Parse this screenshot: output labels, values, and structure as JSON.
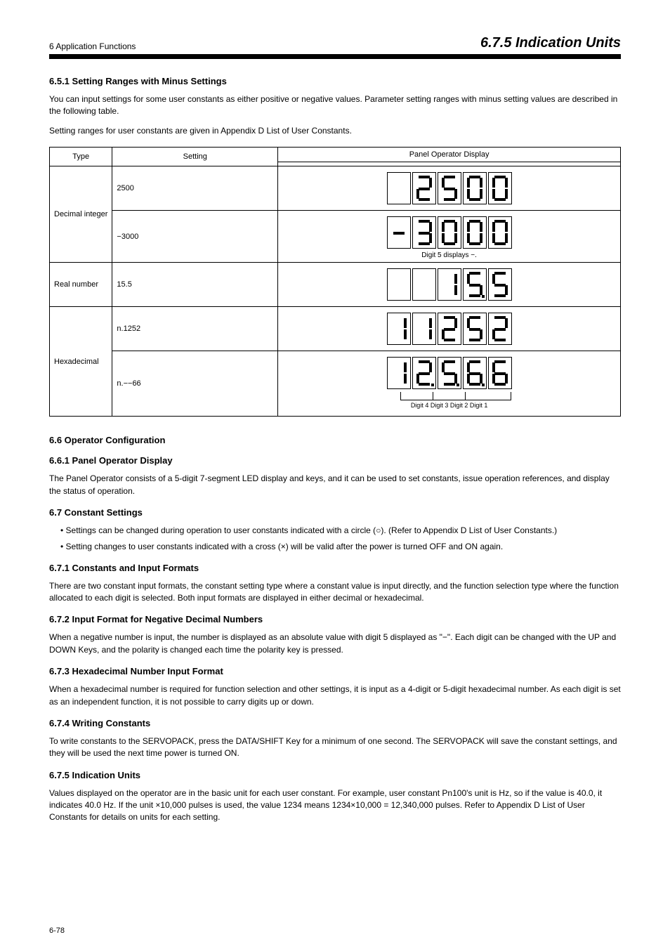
{
  "header": {
    "chapter": "6 Application Functions",
    "section_title": "6.7.5 Indication Units"
  },
  "h651": "6.5.1  Setting Ranges with Minus Settings",
  "p1": "You can input settings for some user constants as either positive or negative values. Parameter setting ranges with minus setting values are described in the following table.",
  "p2": "Setting ranges for user constants are given in Appendix D List of User Constants.",
  "h66": "6.6  Operator Configuration",
  "h661": "6.6.1  Panel Operator Display",
  "p3": "The Panel Operator consists of a 5-digit 7-segment LED display and keys, and it can be used to set constants, issue operation references, and display the status of operation.",
  "h67": "6.7  Constant Settings",
  "ul": [
    "Settings can be changed during operation to user constants indicated with a circle (○). (Refer to Appendix D List of User Constants.)",
    "Setting changes to user constants indicated with a cross (×) will be valid after the power is turned OFF and ON again."
  ],
  "table": {
    "hdr_type": "Type",
    "hdr_set": "Setting",
    "hdr_disp": "Panel Operator Display",
    "rows": [
      {
        "type": "Decimal integer",
        "sets": [
          {
            "set": "2500",
            "digits": [
              " ",
              "2",
              "5",
              "0",
              "0"
            ],
            "cap": ""
          },
          {
            "set": "−3000",
            "digits": [
              "-",
              "3",
              "0",
              "0",
              "0"
            ],
            "cap": "Digit 5 displays −."
          }
        ]
      },
      {
        "type": "Real number",
        "sets": [
          {
            "set": "15.5",
            "digits": [
              " ",
              " ",
              "1",
              "5.",
              "5"
            ],
            "cap": ""
          }
        ]
      },
      {
        "type": "Hexadecimal",
        "sets": [
          {
            "set": "n.1252",
            "digits": [
              "1",
              "1",
              "2",
              "5",
              "2"
            ],
            "cap": ""
          },
          {
            "set": "n.−−66",
            "digits": [
              "1",
              "2.",
              "5.",
              "6.",
              "6"
            ],
            "cap": "arrows"
          }
        ]
      }
    ],
    "arrow_labels": "Digit 4  Digit 3  Digit 2  Digit 1"
  },
  "h671": "6.7.1  Constants and Input Formats",
  "p671": "There are two constant input formats, the constant setting type where a constant value is input directly, and the function selection type where the function allocated to each digit is selected. Both input formats are displayed in either decimal or hexadecimal.",
  "h672": "6.7.2  Input Format for Negative Decimal Numbers",
  "p672": "When a negative number is input, the number is displayed as an absolute value with digit 5 displayed as \"−\". Each digit can be changed with the UP and DOWN Keys, and the polarity is changed each time the polarity key is pressed.",
  "h673": "6.7.3  Hexadecimal Number Input Format",
  "p673": "When a hexadecimal number is required for function selection and other settings, it is input as a 4-digit or 5-digit hexadecimal number. As each digit is set as an independent function, it is not possible to carry digits up or down.",
  "h674": "6.7.4  Writing Constants",
  "p674": "To write constants to the SERVOPACK, press the DATA/SHIFT Key for a minimum of one second. The SERVOPACK will save the constant settings, and they will be used the next time power is turned ON.",
  "h675": "6.7.5  Indication Units",
  "p675": "Values displayed on the operator are in the basic unit for each user constant. For example, user constant Pn100's unit is Hz, so if the value is 40.0, it indicates 40.0 Hz. If the unit ×10,000 pulses is used, the value 1234 means 1234×10,000 = 12,340,000 pulses. Refer to Appendix D List of User Constants for details on units for each setting.",
  "footer": {
    "left": "6-78",
    "right": ""
  }
}
